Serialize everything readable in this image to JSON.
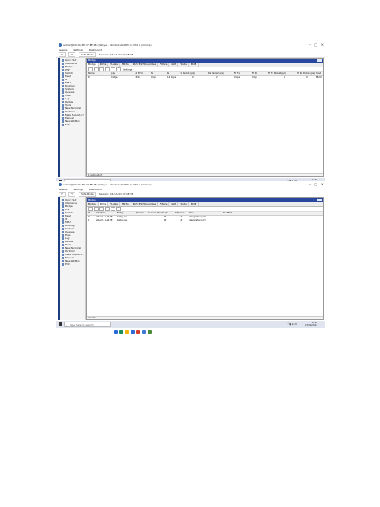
{
  "screens": [
    {
      "title_text": "admin@D4:CA:6D:37:BE:98 (Rafaye) - WinBox v6.48.3 on hEX S (mmips)",
      "menu": [
        "Session",
        "Settings",
        "Dashboard"
      ],
      "toolbar": {
        "safe_mode": "Safe Mode",
        "session_text": "Session: D4:CA:6D:37:BE:98"
      },
      "sidebar": [
        "Quick Set",
        "Interfaces",
        "Bridge",
        "PPP",
        "Switch",
        "Mesh",
        "IP",
        "MPLS",
        "Routing",
        "System",
        "Queues",
        "Files",
        "Log",
        "Radius",
        "Tools",
        "New Terminal",
        "Partition",
        "Make Supout.rif",
        "Manual",
        "New WinBox",
        "Exit"
      ],
      "panel_title": "Bridge",
      "tabs": [
        "Bridge",
        "Ports",
        "VLANs",
        "MSTIs",
        "Port MST Overrides",
        "Filters",
        "NAT",
        "Hosts",
        "MDB"
      ],
      "active_tab": "Bridge",
      "filter_text": "Settings",
      "table": {
        "headers": [
          "Name",
          "Type",
          "L2 MTU",
          "Tx",
          "Rx",
          "Tx Packet (p/s)",
          "Rx Packet (p/s)",
          "FP Tx",
          "FP Rx",
          "FP Tx Packet (p/s)",
          "FP Rx Packet (p/s)",
          "Host"
        ],
        "rows": [
          [
            "R",
            "Bridge",
            "1596",
            "0 bps",
            "1.4 kbps",
            "0",
            "2",
            "0 bps",
            "0 bps",
            "0",
            "0",
            "B8:69"
          ]
        ]
      },
      "status_text": "1 item out of 3",
      "taskbar": {
        "search_placeholder": "Type here to search",
        "time": "11:40",
        "date": "27/04/2024"
      }
    },
    {
      "title_text": "admin@D4:CA:6D:37:BE:98 (Rafaye) - WinBox v6.48.3 on hEX S (mmips)",
      "menu": [
        "Session",
        "Settings",
        "Dashboard"
      ],
      "toolbar": {
        "safe_mode": "Safe Mode",
        "session_text": "Session: D4:CA:6D:37:BE:98"
      },
      "sidebar": [
        "Quick Set",
        "Interfaces",
        "Bridge",
        "PPP",
        "Switch",
        "Mesh",
        "IP",
        "MPLS",
        "Routing",
        "System",
        "Queues",
        "Files",
        "Log",
        "Radius",
        "Tools",
        "New Terminal",
        "Partition",
        "Make Supout.rif",
        "Manual",
        "New WinBox",
        "Exit"
      ],
      "panel_title": "Bridge",
      "tabs": [
        "Bridge",
        "Ports",
        "VLANs",
        "MSTIs",
        "Port MST Overrides",
        "Filters",
        "NAT",
        "Hosts",
        "MDB"
      ],
      "active_tab": "Ports",
      "filter_text": "",
      "table": {
        "headers": [
          "#",
          "Interface",
          "Bridge",
          "Horizon",
          "Trusted",
          "Priority (h)",
          "Path Cost",
          "Role",
          "Root Pat..."
        ],
        "rows": [
          [
            "0",
            "ether2 - LAN KE",
            "bridge-lan",
            "",
            "",
            "80",
            "10",
            "designated port",
            ""
          ],
          [
            "1",
            "ether3 - LAN KE",
            "bridge-lan",
            "",
            "",
            "80",
            "10",
            "designated port",
            ""
          ]
        ]
      },
      "status_text": "2 items",
      "taskbar": {
        "search_placeholder": "Type here to search",
        "time": "11:42",
        "date": "27/04/2024"
      }
    }
  ]
}
